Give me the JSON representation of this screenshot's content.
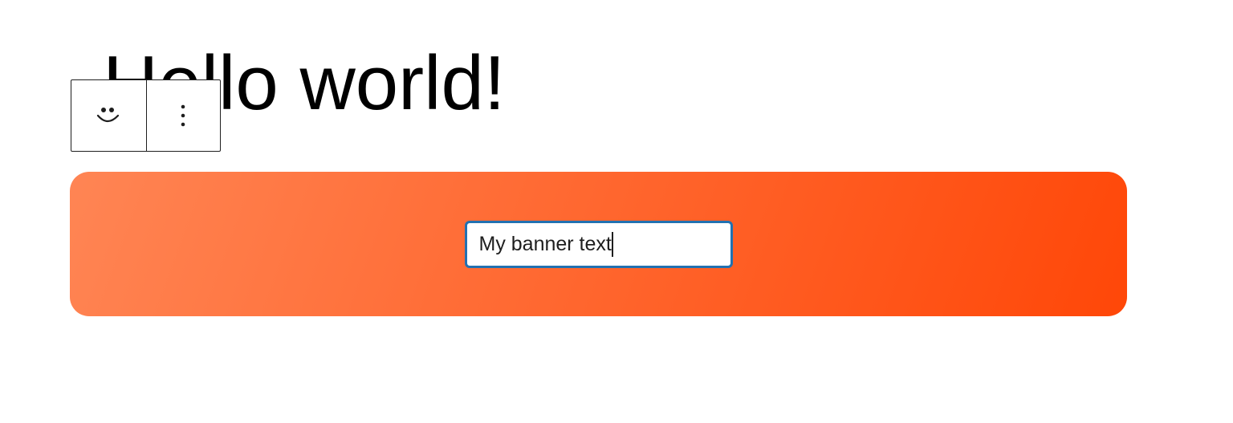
{
  "post": {
    "title": "Hello world!"
  },
  "block_toolbar": {
    "block_icon": "smiley-face-icon",
    "options_icon": "more-vertical-icon"
  },
  "banner": {
    "text": "My banner text",
    "gradient_start": "#ff8554",
    "gradient_end": "#ff4708",
    "input_border_color": "#2271b1"
  }
}
